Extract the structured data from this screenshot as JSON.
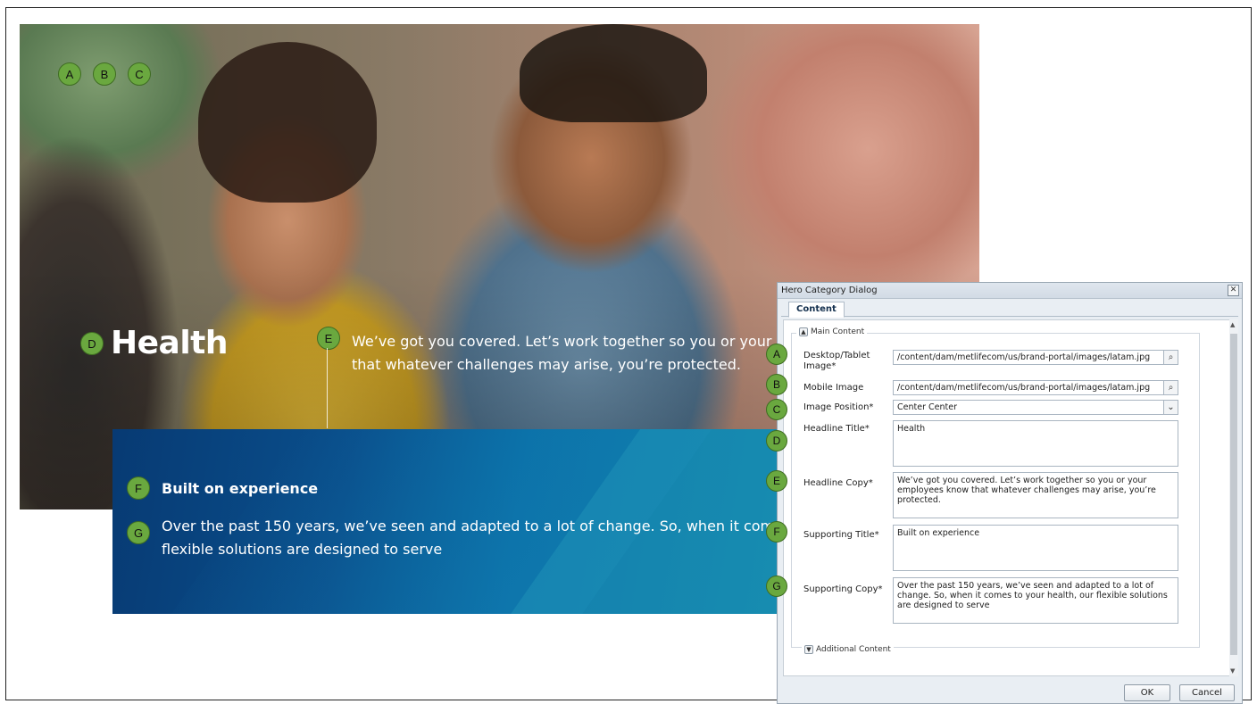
{
  "hero": {
    "markers": [
      "A",
      "B",
      "C"
    ],
    "title_marker": "D",
    "title": "Health",
    "copy_marker": "E",
    "copy_line1": "We’ve got you covered. Let’s work together so you or your employees know",
    "copy_line2": "that whatever challenges may arise, you’re protected."
  },
  "panel": {
    "title_marker": "F",
    "title": "Built on experience",
    "copy_marker": "G",
    "copy_line1": "Over the past 150 years, we’ve seen and adapted to a lot of change. So, when it comes to your health, our",
    "copy_line2": "flexible solutions are designed to serve"
  },
  "dialog": {
    "title": "Hero Category Dialog",
    "close": "✕",
    "tab": "Content",
    "section": "Main Content",
    "section_toggle": "▲",
    "additional": "Additional Content",
    "additional_toggle": "▼",
    "fields": {
      "desktop_label": "Desktop/Tablet Image*",
      "desktop_marker": "A",
      "desktop_value": "/content/dam/metlifecom/us/brand-portal/images/latam.jpg",
      "mobile_label": "Mobile Image",
      "mobile_marker": "B",
      "mobile_value": "/content/dam/metlifecom/us/brand-portal/images/latam.jpg",
      "position_label": "Image Position*",
      "position_marker": "C",
      "position_value": "Center Center",
      "headline_title_label": "Headline Title*",
      "headline_title_marker": "D",
      "headline_title_value": "Health",
      "headline_copy_label": "Headline Copy*",
      "headline_copy_marker": "E",
      "headline_copy_value": "We’ve got you covered. Let’s work together so you or your employees know that whatever challenges may arise, you’re protected.",
      "supporting_title_label": "Supporting Title*",
      "supporting_title_marker": "F",
      "supporting_title_value": "Built on experience",
      "supporting_copy_label": "Supporting Copy*",
      "supporting_copy_marker": "G",
      "supporting_copy_value": "Over the past 150 years, we’ve seen and adapted to a lot of change. So, when it comes to your health, our flexible solutions are designed to serve"
    },
    "ok": "OK",
    "cancel": "Cancel"
  },
  "icons": {
    "search": "search-icon",
    "dropdown": "chevron-down-icon",
    "close": "close-icon"
  },
  "colors": {
    "marker_green": "#6aa83f",
    "panel_blue": "#0a4f8c"
  }
}
